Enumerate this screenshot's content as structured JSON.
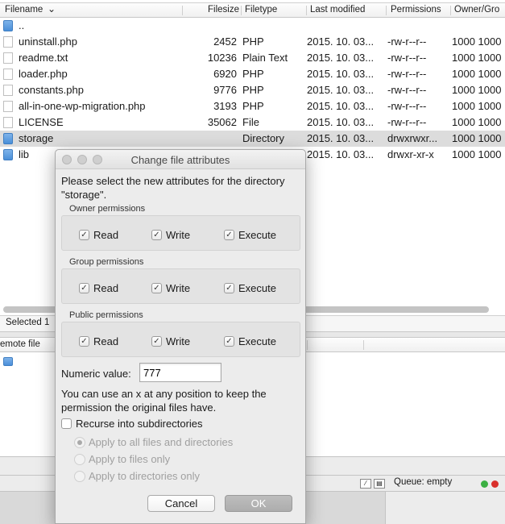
{
  "columns": {
    "filename": "Filename",
    "filesize": "Filesize",
    "filetype": "Filetype",
    "last_modified": "Last modified",
    "permissions": "Permissions",
    "owner_group": "Owner/Gro"
  },
  "sort_indicator": "chevron-down-icon",
  "files": [
    {
      "name": "..",
      "size": "",
      "type": "",
      "modified": "",
      "perms": "",
      "owner": "",
      "icon": "folder-icon"
    },
    {
      "name": "uninstall.php",
      "size": "2452",
      "type": "PHP",
      "modified": "2015. 10. 03...",
      "perms": "-rw-r--r--",
      "owner": "1000 1000",
      "icon": "file-icon"
    },
    {
      "name": "readme.txt",
      "size": "10236",
      "type": "Plain Text",
      "modified": "2015. 10. 03...",
      "perms": "-rw-r--r--",
      "owner": "1000 1000",
      "icon": "file-icon"
    },
    {
      "name": "loader.php",
      "size": "6920",
      "type": "PHP",
      "modified": "2015. 10. 03...",
      "perms": "-rw-r--r--",
      "owner": "1000 1000",
      "icon": "file-icon"
    },
    {
      "name": "constants.php",
      "size": "9776",
      "type": "PHP",
      "modified": "2015. 10. 03...",
      "perms": "-rw-r--r--",
      "owner": "1000 1000",
      "icon": "file-icon"
    },
    {
      "name": "all-in-one-wp-migration.php",
      "size": "3193",
      "type": "PHP",
      "modified": "2015. 10. 03...",
      "perms": "-rw-r--r--",
      "owner": "1000 1000",
      "icon": "file-icon"
    },
    {
      "name": "LICENSE",
      "size": "35062",
      "type": "File",
      "modified": "2015. 10. 03...",
      "perms": "-rw-r--r--",
      "owner": "1000 1000",
      "icon": "file-icon"
    },
    {
      "name": "storage",
      "size": "",
      "type": "Directory",
      "modified": "2015. 10. 03...",
      "perms": "drwxrwxr...",
      "owner": "1000 1000",
      "icon": "folder-icon",
      "selected": true
    },
    {
      "name": "lib",
      "size": "",
      "type": "",
      "modified": "2015. 10. 03...",
      "perms": "drwxr-xr-x",
      "owner": "1000 1000",
      "icon": "folder-icon"
    }
  ],
  "status_line": "Selected 1",
  "remote_header": "emote file",
  "status_bar": {
    "queue": "Queue: empty",
    "queue_icon": "queue-icon",
    "led_green": "#3cb043",
    "led_red": "#d9302c"
  },
  "dialog": {
    "title": "Change file attributes",
    "instruction_line1": "Please select the new attributes for the directory",
    "instruction_line2": "\"storage\".",
    "groups": [
      {
        "label": "Owner permissions",
        "read": "Read",
        "write": "Write",
        "execute": "Execute",
        "read_checked": true,
        "write_checked": true,
        "execute_checked": true
      },
      {
        "label": "Group permissions",
        "read": "Read",
        "write": "Write",
        "execute": "Execute",
        "read_checked": true,
        "write_checked": true,
        "execute_checked": true
      },
      {
        "label": "Public permissions",
        "read": "Read",
        "write": "Write",
        "execute": "Execute",
        "read_checked": true,
        "write_checked": true,
        "execute_checked": true
      }
    ],
    "numeric_label": "Numeric value:",
    "numeric_value": "777",
    "hint_line1": "You can use an x at any position to keep the",
    "hint_line2": "permission the original files have.",
    "recurse_label": "Recurse into subdirectories",
    "recurse_checked": false,
    "radios": [
      {
        "label": "Apply to all files and directories",
        "selected": true
      },
      {
        "label": "Apply to files only",
        "selected": false
      },
      {
        "label": "Apply to directories only",
        "selected": false
      }
    ],
    "cancel_label": "Cancel",
    "ok_label": "OK",
    "check_glyph": "✓"
  }
}
